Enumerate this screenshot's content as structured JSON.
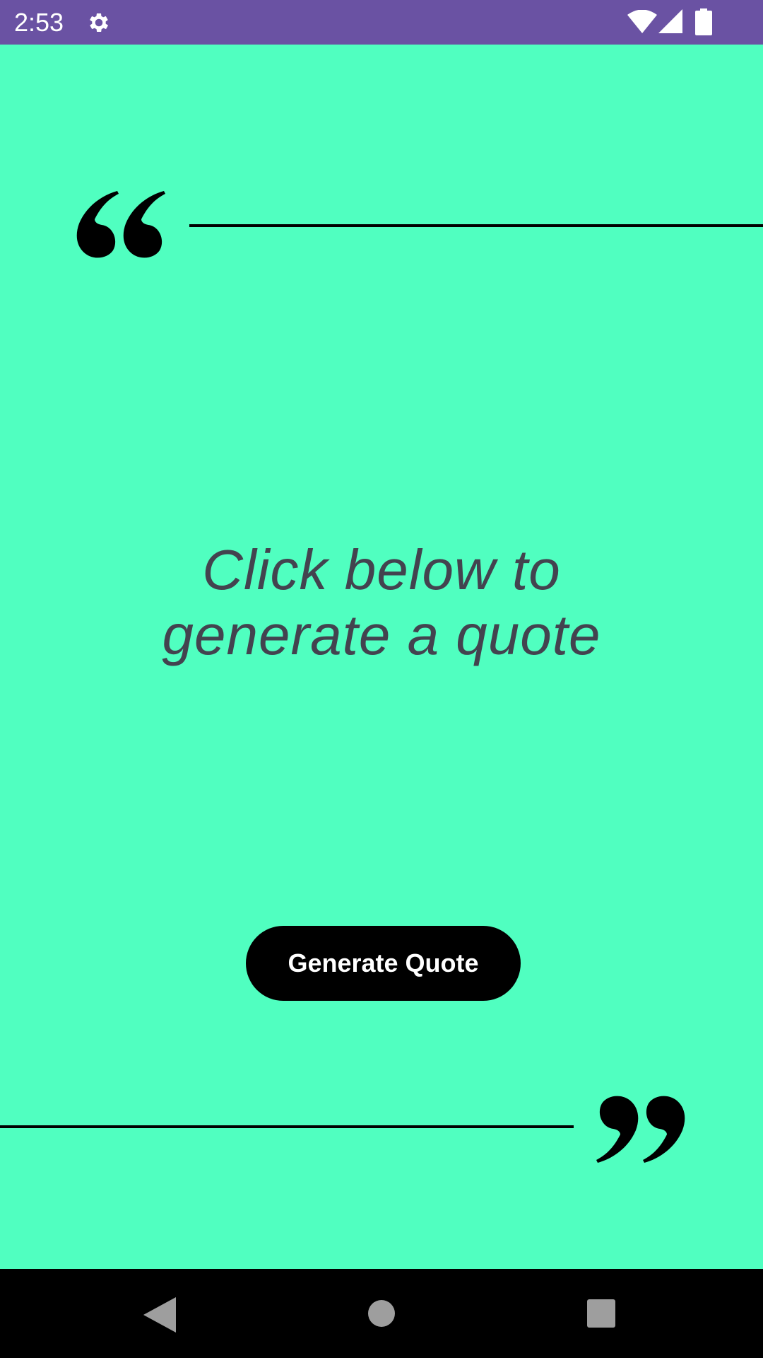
{
  "status_bar": {
    "time": "2:53",
    "icons": [
      "gear-icon",
      "wifi-icon",
      "signal-icon",
      "battery-icon"
    ],
    "background": "#6A52A3"
  },
  "main": {
    "background": "#50FFC0",
    "quote_line1": "Click below to",
    "quote_line2": "generate a quote",
    "generate_button_label": "Generate Quote",
    "decorations": [
      "quote-open-icon",
      "quote-close-icon"
    ]
  },
  "nav_bar": {
    "icons": [
      "back-icon",
      "home-icon",
      "recents-icon"
    ]
  }
}
